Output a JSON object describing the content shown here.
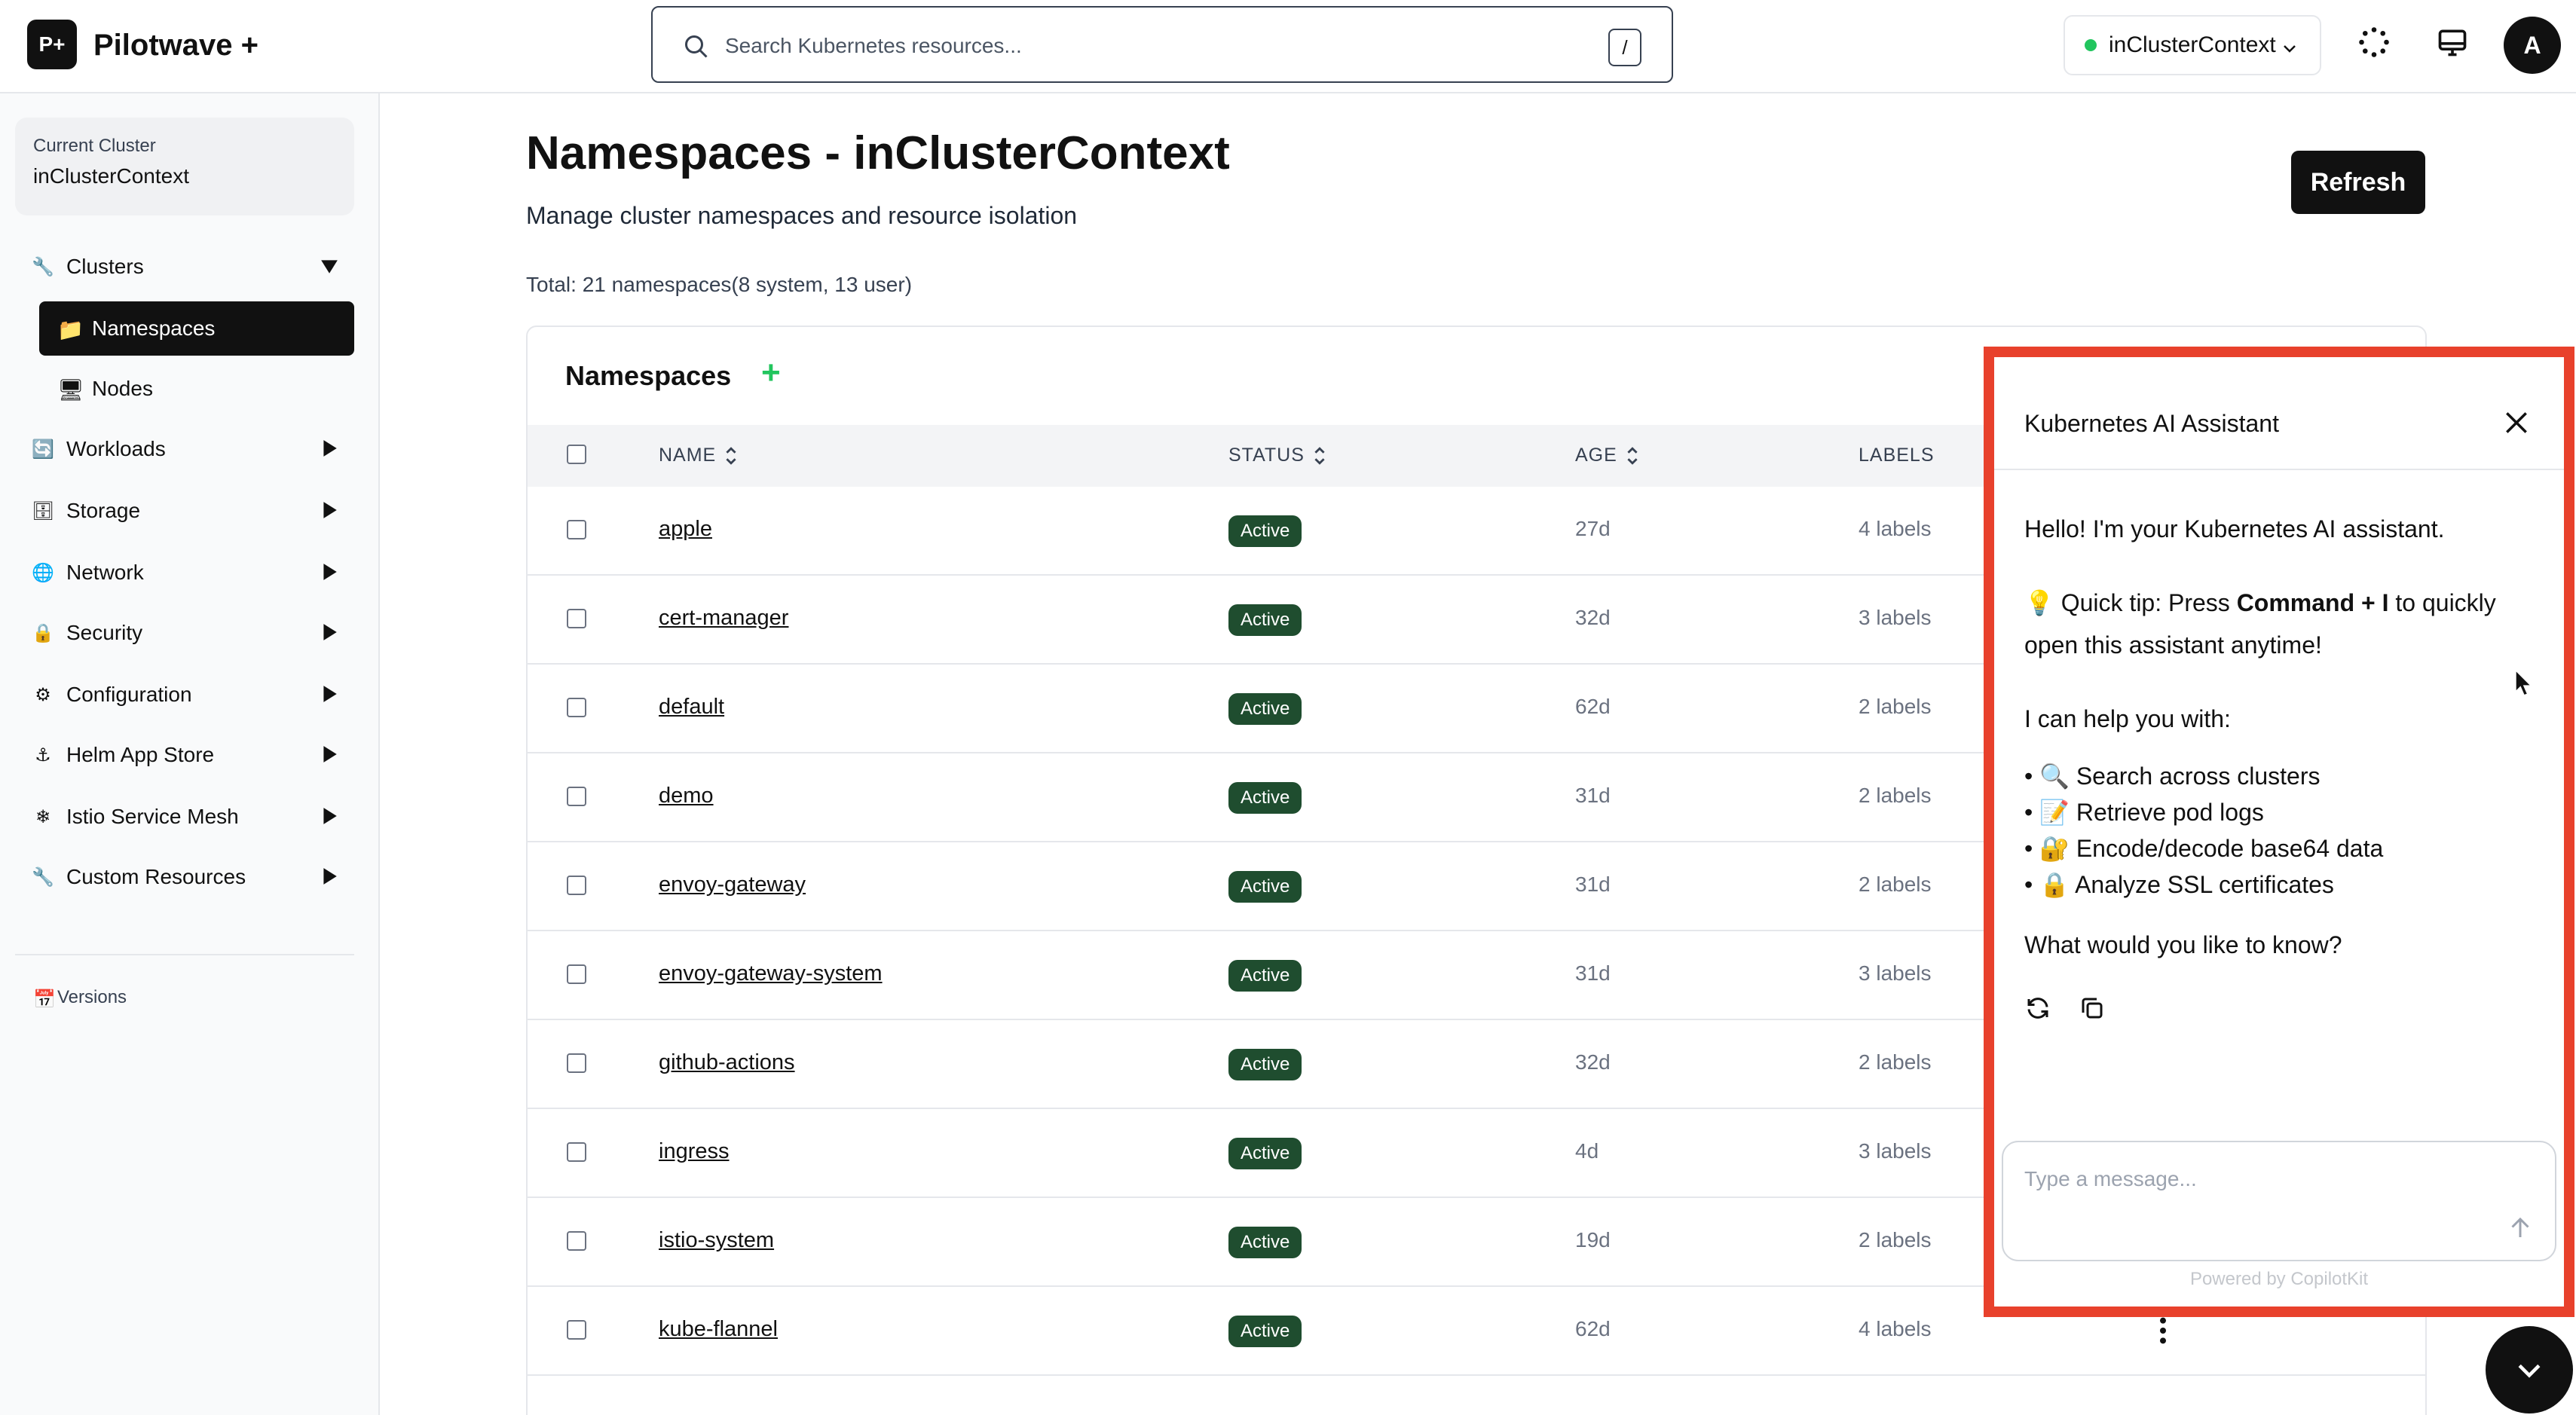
{
  "header": {
    "logo": "P+",
    "app_name": "Pilotwave +",
    "search_placeholder": "Search Kubernetes resources...",
    "search_shortcut": "/",
    "cluster_context": "inClusterContext",
    "avatar_initial": "A"
  },
  "sidebar": {
    "current_cluster_label": "Current Cluster",
    "current_cluster_value": "inClusterContext",
    "items": [
      {
        "label": "Clusters",
        "icon": "wrench-icon"
      },
      {
        "label": "Namespaces",
        "icon": "folder-icon"
      },
      {
        "label": "Nodes",
        "icon": "monitor-icon"
      },
      {
        "label": "Workloads",
        "icon": "workloads-icon"
      },
      {
        "label": "Storage",
        "icon": "storage-icon"
      },
      {
        "label": "Network",
        "icon": "globe-icon"
      },
      {
        "label": "Security",
        "icon": "lock-icon"
      },
      {
        "label": "Configuration",
        "icon": "gear-icon"
      },
      {
        "label": "Helm App Store",
        "icon": "anchor-icon"
      },
      {
        "label": "Istio Service Mesh",
        "icon": "snowflake-icon"
      },
      {
        "label": "Custom Resources",
        "icon": "wrench-icon"
      }
    ],
    "versions": "Versions"
  },
  "main": {
    "title": "Namespaces - inClusterContext",
    "subtitle": "Manage cluster namespaces and resource isolation",
    "refresh_label": "Refresh",
    "total": "Total: 21 namespaces(8 system, 13 user)",
    "table": {
      "title": "Namespaces",
      "add_label": "+",
      "columns": [
        "NAME",
        "STATUS",
        "AGE",
        "LABELS"
      ],
      "rows": [
        {
          "name": "apple",
          "status": "Active",
          "age": "27d",
          "labels": "4 labels"
        },
        {
          "name": "cert-manager",
          "status": "Active",
          "age": "32d",
          "labels": "3 labels"
        },
        {
          "name": "default",
          "status": "Active",
          "age": "62d",
          "labels": "2 labels"
        },
        {
          "name": "demo",
          "status": "Active",
          "age": "31d",
          "labels": "2 labels"
        },
        {
          "name": "envoy-gateway",
          "status": "Active",
          "age": "31d",
          "labels": "2 labels"
        },
        {
          "name": "envoy-gateway-system",
          "status": "Active",
          "age": "31d",
          "labels": "3 labels"
        },
        {
          "name": "github-actions",
          "status": "Active",
          "age": "32d",
          "labels": "2 labels"
        },
        {
          "name": "ingress",
          "status": "Active",
          "age": "4d",
          "labels": "3 labels"
        },
        {
          "name": "istio-system",
          "status": "Active",
          "age": "19d",
          "labels": "2 labels"
        },
        {
          "name": "kube-flannel",
          "status": "Active",
          "age": "62d",
          "labels": "4 labels"
        }
      ]
    }
  },
  "assistant": {
    "title": "Kubernetes AI Assistant",
    "greeting": "Hello! I'm your Kubernetes AI assistant.",
    "tip_prefix": "💡 Quick tip: Press ",
    "tip_bold": "Command + I",
    "tip_suffix": " to quickly open this assistant anytime!",
    "help_intro": "I can help you with:",
    "capabilities": [
      "🔍 Search across clusters",
      "📝 Retrieve pod logs",
      "🔐 Encode/decode base64 data",
      "🔒 Analyze SSL certificates"
    ],
    "question": "What would you like to know?",
    "input_placeholder": "Type a message...",
    "powered_by": "Powered by CopilotKit"
  },
  "colors": {
    "accent": "#111111",
    "badge_green": "#1f4d2f",
    "highlight_red": "#e8412c",
    "status_dot": "#22c55e"
  }
}
